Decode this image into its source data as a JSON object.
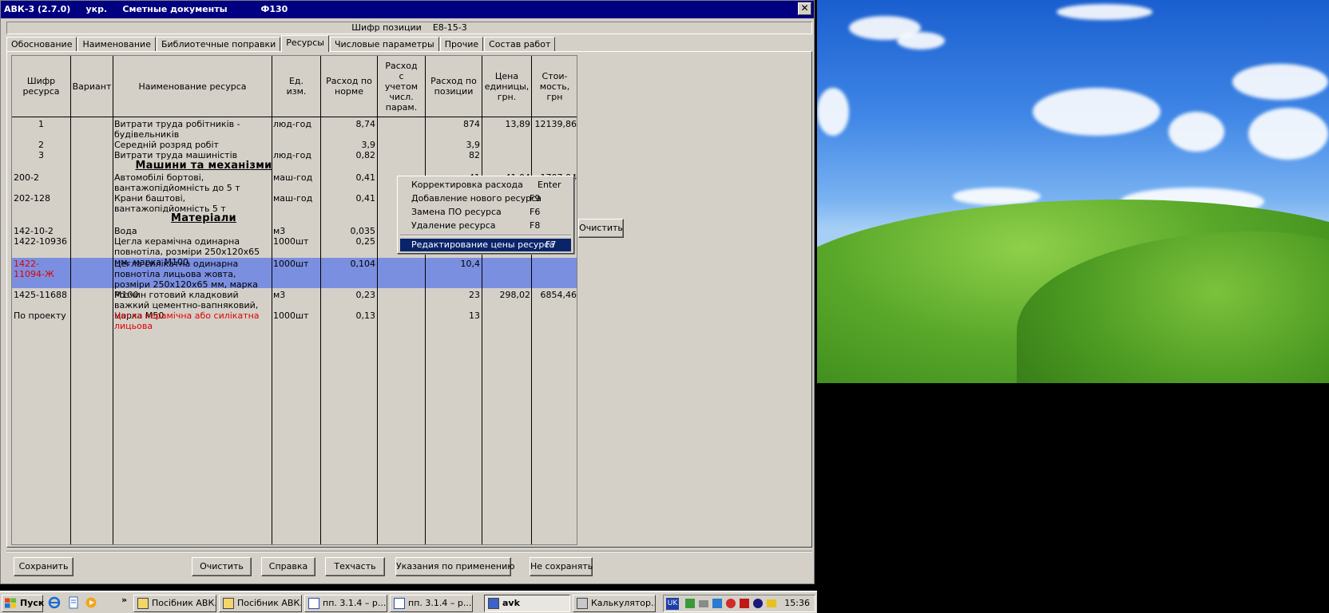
{
  "window": {
    "app": "АВК-3 (2.7.0)",
    "lang": "укр.",
    "module": "Сметные документы",
    "form": "Ф130",
    "close_glyph": "✕"
  },
  "cipher": {
    "label": "Шифр позиции",
    "value": "Е8-15-3"
  },
  "tabs": [
    "Обоснование",
    "Наименование",
    "Библиотечные поправки",
    "Ресурсы",
    "Числовые параметры",
    "Прочие",
    "Состав работ"
  ],
  "active_tab": "Ресурсы",
  "table": {
    "headers": [
      "Шифр ресурса",
      "Вариант",
      "Наименование ресурса",
      "Ед. изм.",
      "Расход по норме",
      "Расход с учетом числ. парам.",
      "Расход по позиции",
      "Цена единицы, грн.",
      "Стои-мость, грн"
    ],
    "rows": [
      {
        "code": "1",
        "variant": "",
        "name": "Витрати труда робітників - будівельників",
        "unit": "люд-год",
        "norm": "8,74",
        "param": "",
        "pos": "874",
        "price": "13,89",
        "cost": "12139,86"
      },
      {
        "code": "2",
        "variant": "",
        "name": "Середній розряд робіт",
        "unit": "",
        "norm": "3,9",
        "param": "",
        "pos": "3,9",
        "price": "",
        "cost": ""
      },
      {
        "code": "3",
        "variant": "",
        "name": "Витрати труда машиністів",
        "unit": "люд-год",
        "norm": "0,82",
        "param": "",
        "pos": "82",
        "price": "",
        "cost": ""
      },
      {
        "code": "200-2",
        "variant": "",
        "name": "Автомобілі бортові, вантажопідйомність до 5 т",
        "unit": "маш-год",
        "norm": "0,41",
        "param": "",
        "pos": "41",
        "price": "",
        "cost": ""
      },
      {
        "code": "202-128",
        "variant": "",
        "name": "Крани баштові, вантажопідйомність 5 т",
        "unit": "маш-год",
        "norm": "0,41",
        "param": "",
        "pos": "",
        "price": "",
        "cost": ""
      },
      {
        "code": "142-10-2",
        "variant": "",
        "name": "Вода",
        "unit": "м3",
        "norm": "0,035",
        "param": "",
        "pos": "",
        "price": "",
        "cost": ""
      },
      {
        "code": "1422-10936",
        "variant": "",
        "name": "Цегла керамічна одинарна повнотіла, розміри 250х120х65 мм, марка М100",
        "unit": "1000шт",
        "norm": "0,25",
        "param": "",
        "pos": "",
        "price": "",
        "cost": ""
      },
      {
        "code": "1422-11094-Ж",
        "variant": "",
        "name": "Цегла силікатна одинарна повнотіла лицьова жовта, розміри 250х120х65 мм, марка М100",
        "unit": "1000шт",
        "norm": "0,104",
        "param": "",
        "pos": "10,4",
        "price": "",
        "cost": ""
      },
      {
        "code": "1425-11688",
        "variant": "",
        "name": "Розчин готовий кладковий важкий цементно-вапняковий, марка М50",
        "unit": "м3",
        "norm": "0,23",
        "param": "",
        "pos": "23",
        "price": "298,02",
        "cost": "6854,46"
      },
      {
        "code": "По проекту",
        "variant": "",
        "name": "Цегла керамічна або силікатна лицьова",
        "unit": "1000шт",
        "norm": "0,13",
        "param": "",
        "pos": "13",
        "price": "",
        "cost": ""
      }
    ],
    "sections": [
      "Машини та механізми",
      "Матеріали"
    ],
    "partial_hidden": {
      "row4_price": "41,04",
      "row4_cost": "1707,04"
    }
  },
  "context_menu": [
    {
      "label": "Корректировка расхода",
      "key": "Enter"
    },
    {
      "label": "Добавление нового ресурса",
      "key": "F9"
    },
    {
      "label": "Замена ПО ресурса",
      "key": "F6"
    },
    {
      "label": "Удаление ресурса",
      "key": "F8"
    },
    {
      "label": "Редактирование цены ресурса",
      "key": "F7"
    }
  ],
  "side_button": "Очистить",
  "buttons": {
    "save": "Сохранить",
    "clear": "Очистить",
    "help": "Справка",
    "techpart": "Техчасть",
    "instructions": "Указания по применению",
    "nosave": "Не сохранять"
  },
  "taskbar": {
    "start": "Пуск",
    "tasks": [
      "Посібник АВК...",
      "Посібник АВК...",
      "пп. 3.1.4 – р...",
      "пп. 3.1.4 – р...",
      "avk",
      "Калькулятор..."
    ],
    "active_task": "avk",
    "lang": "UK",
    "time": "15:36"
  }
}
